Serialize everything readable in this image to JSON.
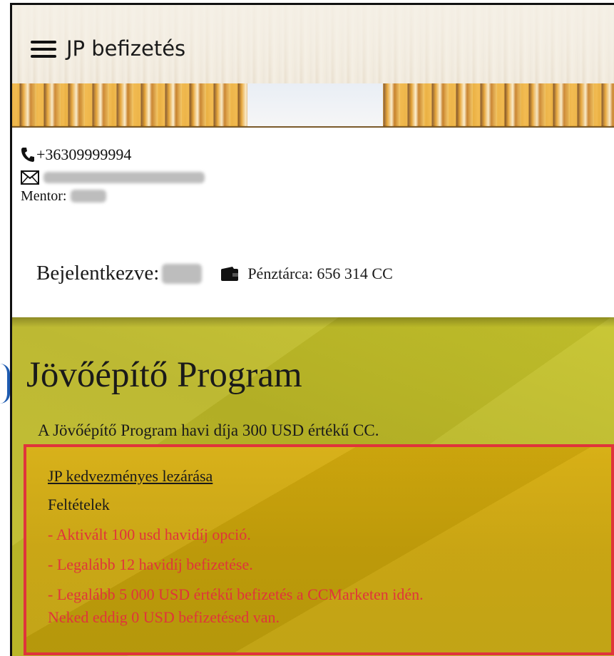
{
  "header": {
    "brand": "JP befizetés"
  },
  "contact": {
    "phone": "+36309999994",
    "mentor_label": "Mentor:"
  },
  "status": {
    "logged_label": "Bejelentkezve:",
    "wallet_label": "Pénztárca: 656 314 CC"
  },
  "program": {
    "title": "Jövőépítő Program",
    "description": "A Jövőépítő Program havi díja 300 USD értékű CC.",
    "link": "JP kedvezményes lezárása",
    "conditions_heading": "Feltételek",
    "conditions": [
      "- Aktivált 100 usd havidíj opció.",
      "- Legalább 12 havidíj befizetése.",
      "- Legalább 5 000 USD értékű befizetés a CCMarketen idén.",
      "Neked eddig 0 USD befizetésed van."
    ]
  },
  "colors": {
    "accent_red": "#e0343b",
    "section_olive": "#c2bd2a",
    "conditions_gold": "#d6ad0e"
  }
}
